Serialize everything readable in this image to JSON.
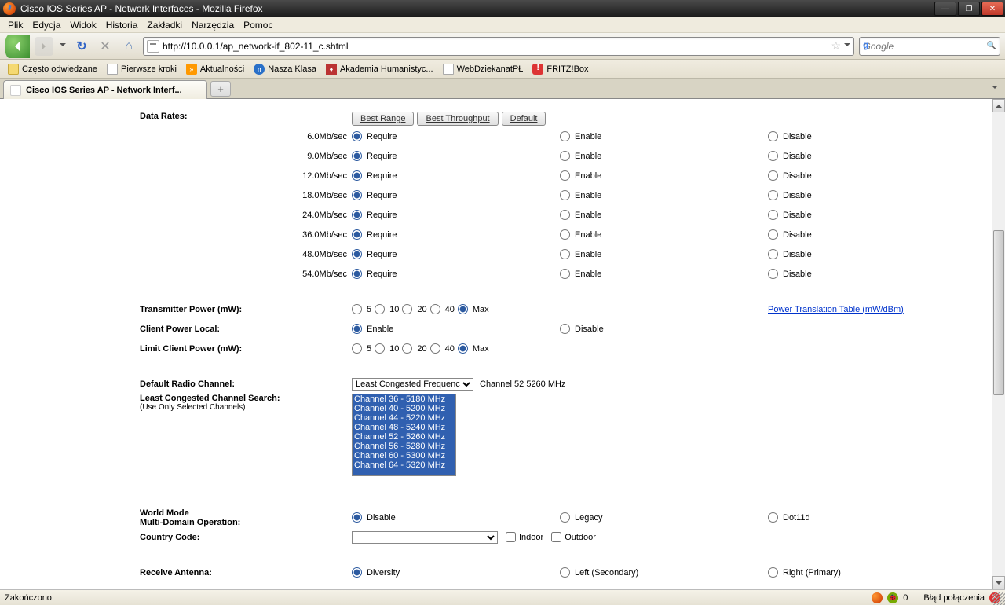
{
  "window": {
    "title": "Cisco IOS Series AP - Network Interfaces - Mozilla Firefox"
  },
  "menus": [
    "Plik",
    "Edycja",
    "Widok",
    "Historia",
    "Zakładki",
    "Narzędzia",
    "Pomoc"
  ],
  "url": "http://10.0.0.1/ap_network-if_802-11_c.shtml",
  "search_placeholder": "Google",
  "bookmarks": [
    {
      "label": "Często odwiedzane",
      "icon": ""
    },
    {
      "label": "Pierwsze kroki",
      "icon": "doc"
    },
    {
      "label": "Aktualności",
      "icon": "rss"
    },
    {
      "label": "Nasza Klasa",
      "icon": "nk"
    },
    {
      "label": "Akademia Humanistyc...",
      "icon": "ah"
    },
    {
      "label": "WebDziekanatPŁ",
      "icon": "doc"
    },
    {
      "label": "FRITZ!Box",
      "icon": "fb"
    }
  ],
  "tab": {
    "label": "Cisco IOS Series AP - Network Interf..."
  },
  "labels": {
    "data_rates": "Data Rates:",
    "tx_power": "Transmitter Power (mW):",
    "client_power_local": "Client Power Local:",
    "limit_client_power": "Limit Client Power (mW):",
    "default_radio_channel": "Default Radio Channel:",
    "least_congested": "Least Congested Channel Search:",
    "least_congested_sub": "(Use Only Selected Channels)",
    "world_mode_l1": "World Mode",
    "world_mode_l2": "Multi-Domain Operation:",
    "country_code": "Country Code:",
    "receive_antenna": "Receive Antenna:",
    "power_translation": "Power Translation Table (mW/dBm)"
  },
  "buttons": {
    "best_range": "Best Range",
    "best_throughput": "Best Throughput",
    "default": "Default"
  },
  "radio_labels": {
    "require": "Require",
    "enable": "Enable",
    "disable": "Disable",
    "legacy": "Legacy",
    "dot11d": "Dot11d",
    "diversity": "Diversity",
    "left_secondary": "Left (Secondary)",
    "right_primary": "Right (Primary)",
    "max": "Max"
  },
  "power_opts": [
    "5",
    "10",
    "20",
    "40"
  ],
  "rates": [
    "6.0Mb/sec",
    "9.0Mb/sec",
    "12.0Mb/sec",
    "18.0Mb/sec",
    "24.0Mb/sec",
    "36.0Mb/sec",
    "48.0Mb/sec",
    "54.0Mb/sec"
  ],
  "freq_select": "Least Congested Frequency",
  "freq_current": "Channel 52 5260 MHz",
  "channel_list": [
    "Channel 36 - 5180 MHz",
    "Channel 40 - 5200 MHz",
    "Channel 44 - 5220 MHz",
    "Channel 48 - 5240 MHz",
    "Channel 52 - 5260 MHz",
    "Channel 56 - 5280 MHz",
    "Channel 60 - 5300 MHz",
    "Channel 64 - 5320 MHz"
  ],
  "checkboxes": {
    "indoor": "Indoor",
    "outdoor": "Outdoor"
  },
  "status": {
    "left": "Zakończono",
    "bug_count": "0",
    "right": "Błąd połączenia"
  }
}
